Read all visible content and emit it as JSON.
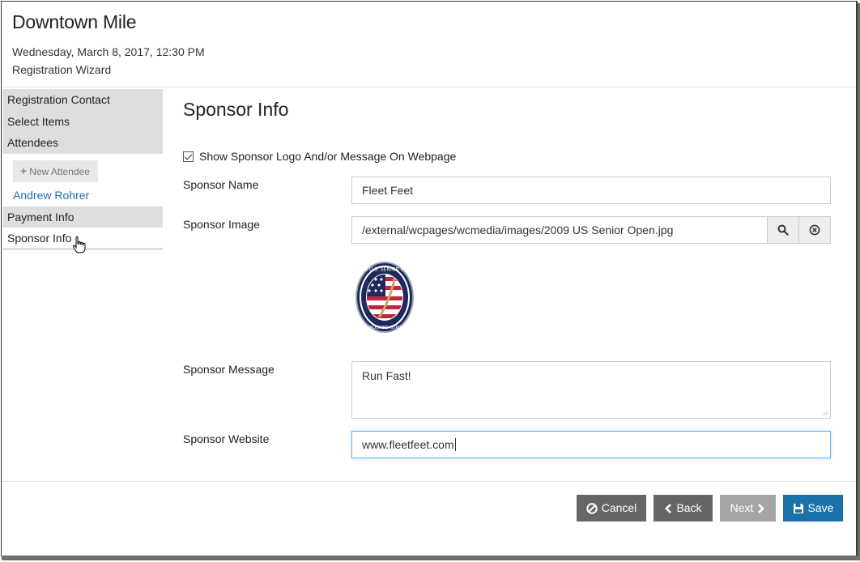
{
  "header": {
    "title": "Downtown Mile",
    "datetime": "Wednesday, March 8, 2017, 12:30 PM",
    "wizard": "Registration Wizard"
  },
  "sidebar": {
    "items": [
      {
        "label": "Registration Contact"
      },
      {
        "label": "Select Items"
      },
      {
        "label": "Attendees"
      }
    ],
    "new_attendee": "New Attendee",
    "attendee_link": "Andrew Rohrer",
    "items2": [
      {
        "label": "Payment Info"
      },
      {
        "label": "Sponsor Info"
      }
    ]
  },
  "main": {
    "title": "Sponsor Info",
    "show_logo_checkbox": {
      "label": "Show Sponsor Logo And/or Message On Webpage",
      "checked": true
    },
    "sponsor_name": {
      "label": "Sponsor Name",
      "value": "Fleet Feet"
    },
    "sponsor_image": {
      "label": "Sponsor Image",
      "value": "/external/wcpages/wcmedia/images/2009 US Senior Open.jpg"
    },
    "logo": {
      "ring_text": "2009 U.S. SENIOR OPEN",
      "bottom_text": "CROOKED STICK"
    },
    "sponsor_message": {
      "label": "Sponsor Message",
      "value": "Run Fast!"
    },
    "sponsor_website": {
      "label": "Sponsor Website",
      "value": "www.fleetfeet.com"
    }
  },
  "footer": {
    "cancel": "Cancel",
    "back": "Back",
    "next": "Next",
    "save": "Save"
  },
  "colors": {
    "primary": "#1b72a9",
    "default_btn": "#666666",
    "disabled_btn": "#a5a5a5",
    "sidebar_bg": "#dedede",
    "link": "#1f6fa8"
  }
}
